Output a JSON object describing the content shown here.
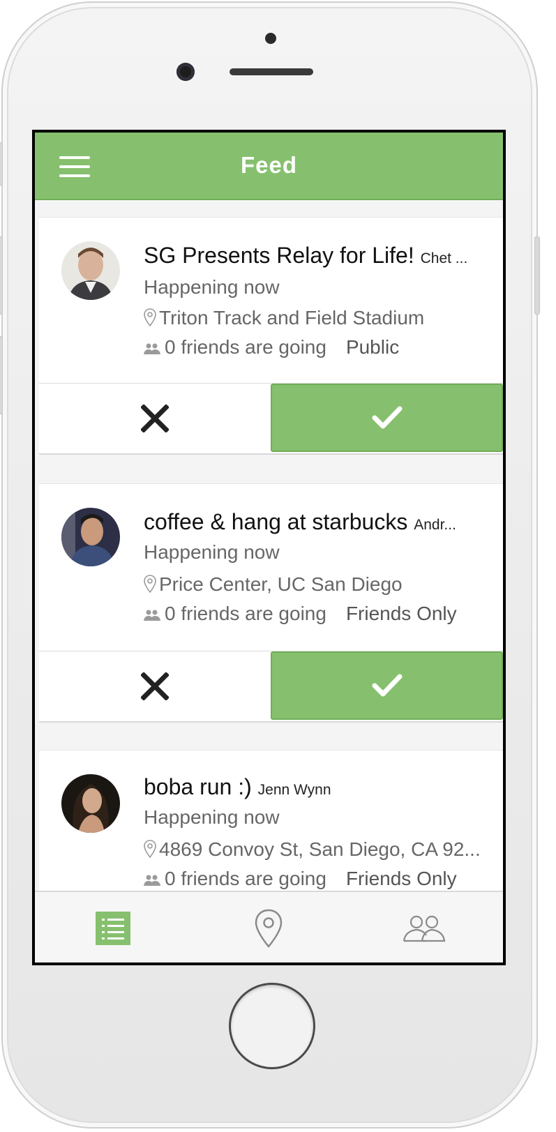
{
  "header": {
    "title": "Feed",
    "menu_icon": "hamburger-menu-icon"
  },
  "colors": {
    "accent": "#86c06e",
    "accent_border": "#6fae57"
  },
  "events": [
    {
      "title": "SG Presents Relay for Life!",
      "host": "Chet ...",
      "time": "Happening now",
      "location": "Triton Track and Field Stadium",
      "friends": "0 friends are going",
      "visibility": "Public"
    },
    {
      "title": "coffee & hang at starbucks",
      "host": "Andr...",
      "time": "Happening now",
      "location": "Price Center, UC San Diego",
      "friends": "0 friends are going",
      "visibility": "Friends Only"
    },
    {
      "title": "boba run :)",
      "host": "Jenn Wynn",
      "time": "Happening now",
      "location": "4869 Convoy St, San Diego, CA 92...",
      "friends": "0 friends are going",
      "visibility": "Friends Only"
    }
  ],
  "actions": {
    "decline_icon": "close-icon",
    "accept_icon": "checkmark-icon"
  },
  "tabs": [
    {
      "icon": "list-icon",
      "active": true
    },
    {
      "icon": "map-pin-icon",
      "active": false
    },
    {
      "icon": "friends-icon",
      "active": false
    }
  ]
}
